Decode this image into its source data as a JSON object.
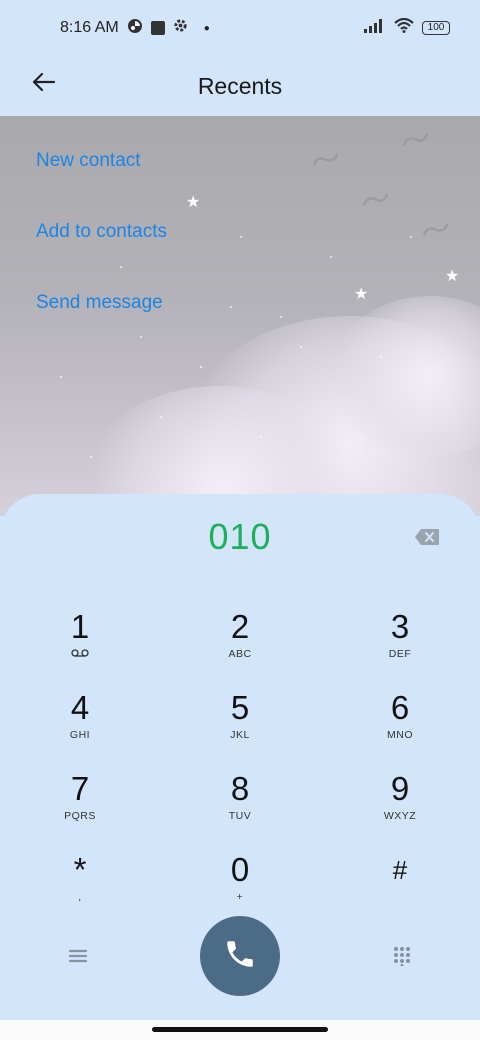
{
  "status_bar": {
    "time": "8:16 AM",
    "battery": "100",
    "icons": [
      "vpn-icon",
      "square-icon",
      "settings-gear-icon",
      "signal-icon",
      "wifi-icon",
      "battery-icon"
    ]
  },
  "header": {
    "title": "Recents"
  },
  "menu": {
    "new_contact": "New contact",
    "add_to_contacts": "Add to contacts",
    "send_message": "Send message"
  },
  "dialer": {
    "number": "010",
    "keys": [
      {
        "digit": "1",
        "letters": ""
      },
      {
        "digit": "2",
        "letters": "ABC"
      },
      {
        "digit": "3",
        "letters": "DEF"
      },
      {
        "digit": "4",
        "letters": "GHI"
      },
      {
        "digit": "5",
        "letters": "JKL"
      },
      {
        "digit": "6",
        "letters": "MNO"
      },
      {
        "digit": "7",
        "letters": "PQRS"
      },
      {
        "digit": "8",
        "letters": "TUV"
      },
      {
        "digit": "9",
        "letters": "WXYZ"
      },
      {
        "digit": "*",
        "letters": ","
      },
      {
        "digit": "0",
        "letters": "+"
      },
      {
        "digit": "#",
        "letters": ""
      }
    ]
  },
  "colors": {
    "accent_link": "#1d84e3",
    "number_green": "#1db057",
    "call_button": "#4c6b87",
    "panel_bg": "#d3e5fb"
  }
}
